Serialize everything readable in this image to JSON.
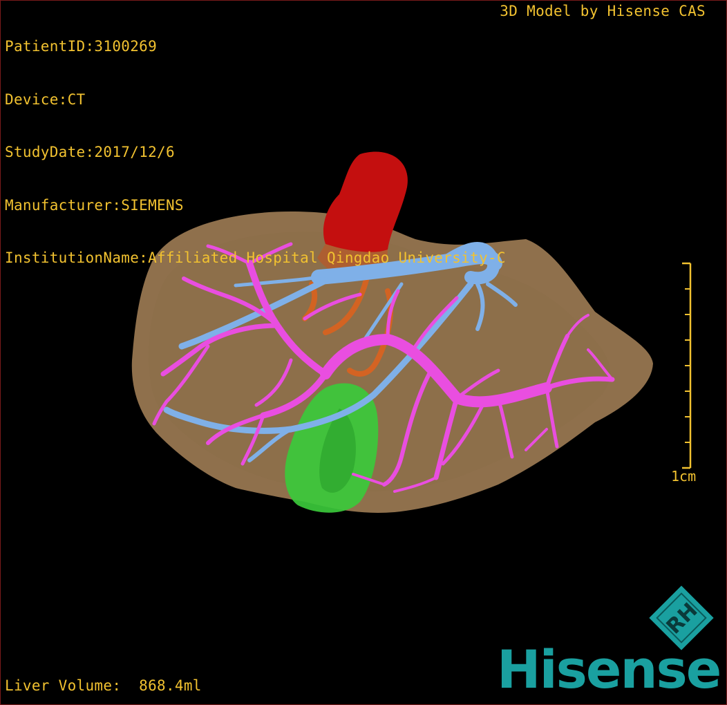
{
  "header": {
    "patient_id": "PatientID:3100269",
    "device": "Device:CT",
    "study_date": "StudyDate:2017/12/6",
    "manufacturer": "Manufacturer:SIEMENS",
    "institution": "InstitutionName:Affiliated Hospital Qingdao University-C"
  },
  "credit": "3D Model by Hisense CAS",
  "footer": {
    "liver_volume": "Liver Volume:  868.4ml"
  },
  "scale_bar": {
    "label": "1cm"
  },
  "brand": {
    "name": "Hisense",
    "logo_letters": "RH"
  },
  "colors": {
    "overlay_text": "#f2c230",
    "liver": "#9b7a52",
    "hepatic_vein": "#7fb0e8",
    "portal_vein": "#e94ee0",
    "artery": "#c40f0f",
    "gallbladder": "#3bc93b",
    "brand": "#1aa0a0"
  }
}
